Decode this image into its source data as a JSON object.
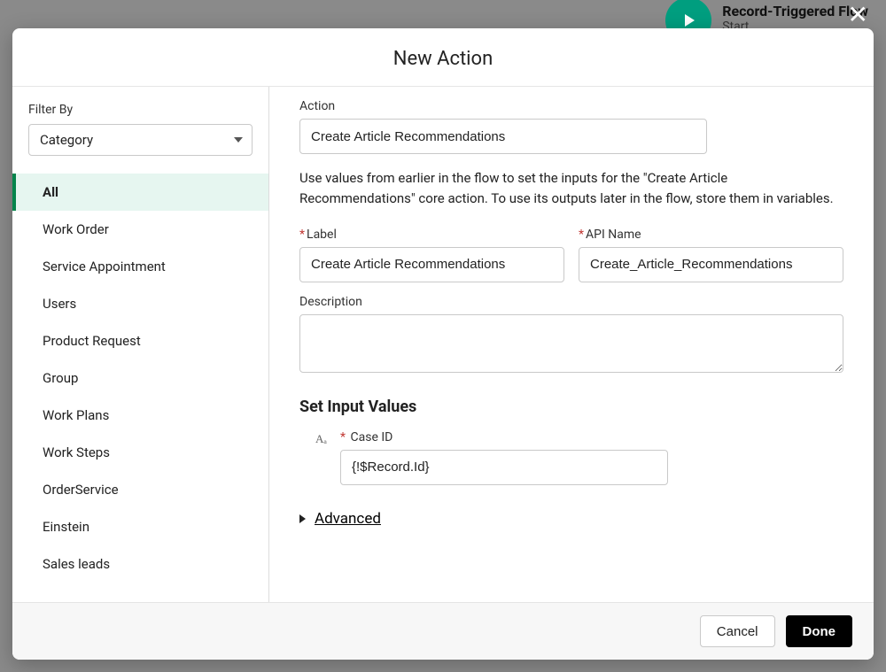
{
  "background": {
    "node_title": "Record-Triggered Flow",
    "node_subtitle": "Start"
  },
  "modal": {
    "title": "New Action"
  },
  "sidebar": {
    "filter_label": "Filter By",
    "filter_value": "Category",
    "categories": [
      {
        "label": "All",
        "selected": true
      },
      {
        "label": "Work Order",
        "selected": false
      },
      {
        "label": "Service Appointment",
        "selected": false
      },
      {
        "label": "Users",
        "selected": false
      },
      {
        "label": "Product Request",
        "selected": false
      },
      {
        "label": "Group",
        "selected": false
      },
      {
        "label": "Work Plans",
        "selected": false
      },
      {
        "label": "Work Steps",
        "selected": false
      },
      {
        "label": "OrderService",
        "selected": false
      },
      {
        "label": "Einstein",
        "selected": false
      },
      {
        "label": "Sales leads",
        "selected": false
      }
    ]
  },
  "main": {
    "action_label": "Action",
    "action_value": "Create Article Recommendations",
    "helper_text": "Use values from earlier in the flow to set the inputs for the \"Create Article Recommendations\" core action. To use its outputs later in the flow, store them in variables.",
    "label_label": "Label",
    "label_value": "Create Article Recommendations",
    "api_name_label": "API Name",
    "api_name_value": "Create_Article_Recommendations",
    "description_label": "Description",
    "description_value": "",
    "section_title": "Set Input Values",
    "input_values": [
      {
        "type_glyph": "Aₐ",
        "label": "Case ID",
        "value": "{!$Record.Id}",
        "required": true
      }
    ],
    "advanced_label": "Advanced"
  },
  "footer": {
    "cancel": "Cancel",
    "done": "Done"
  }
}
